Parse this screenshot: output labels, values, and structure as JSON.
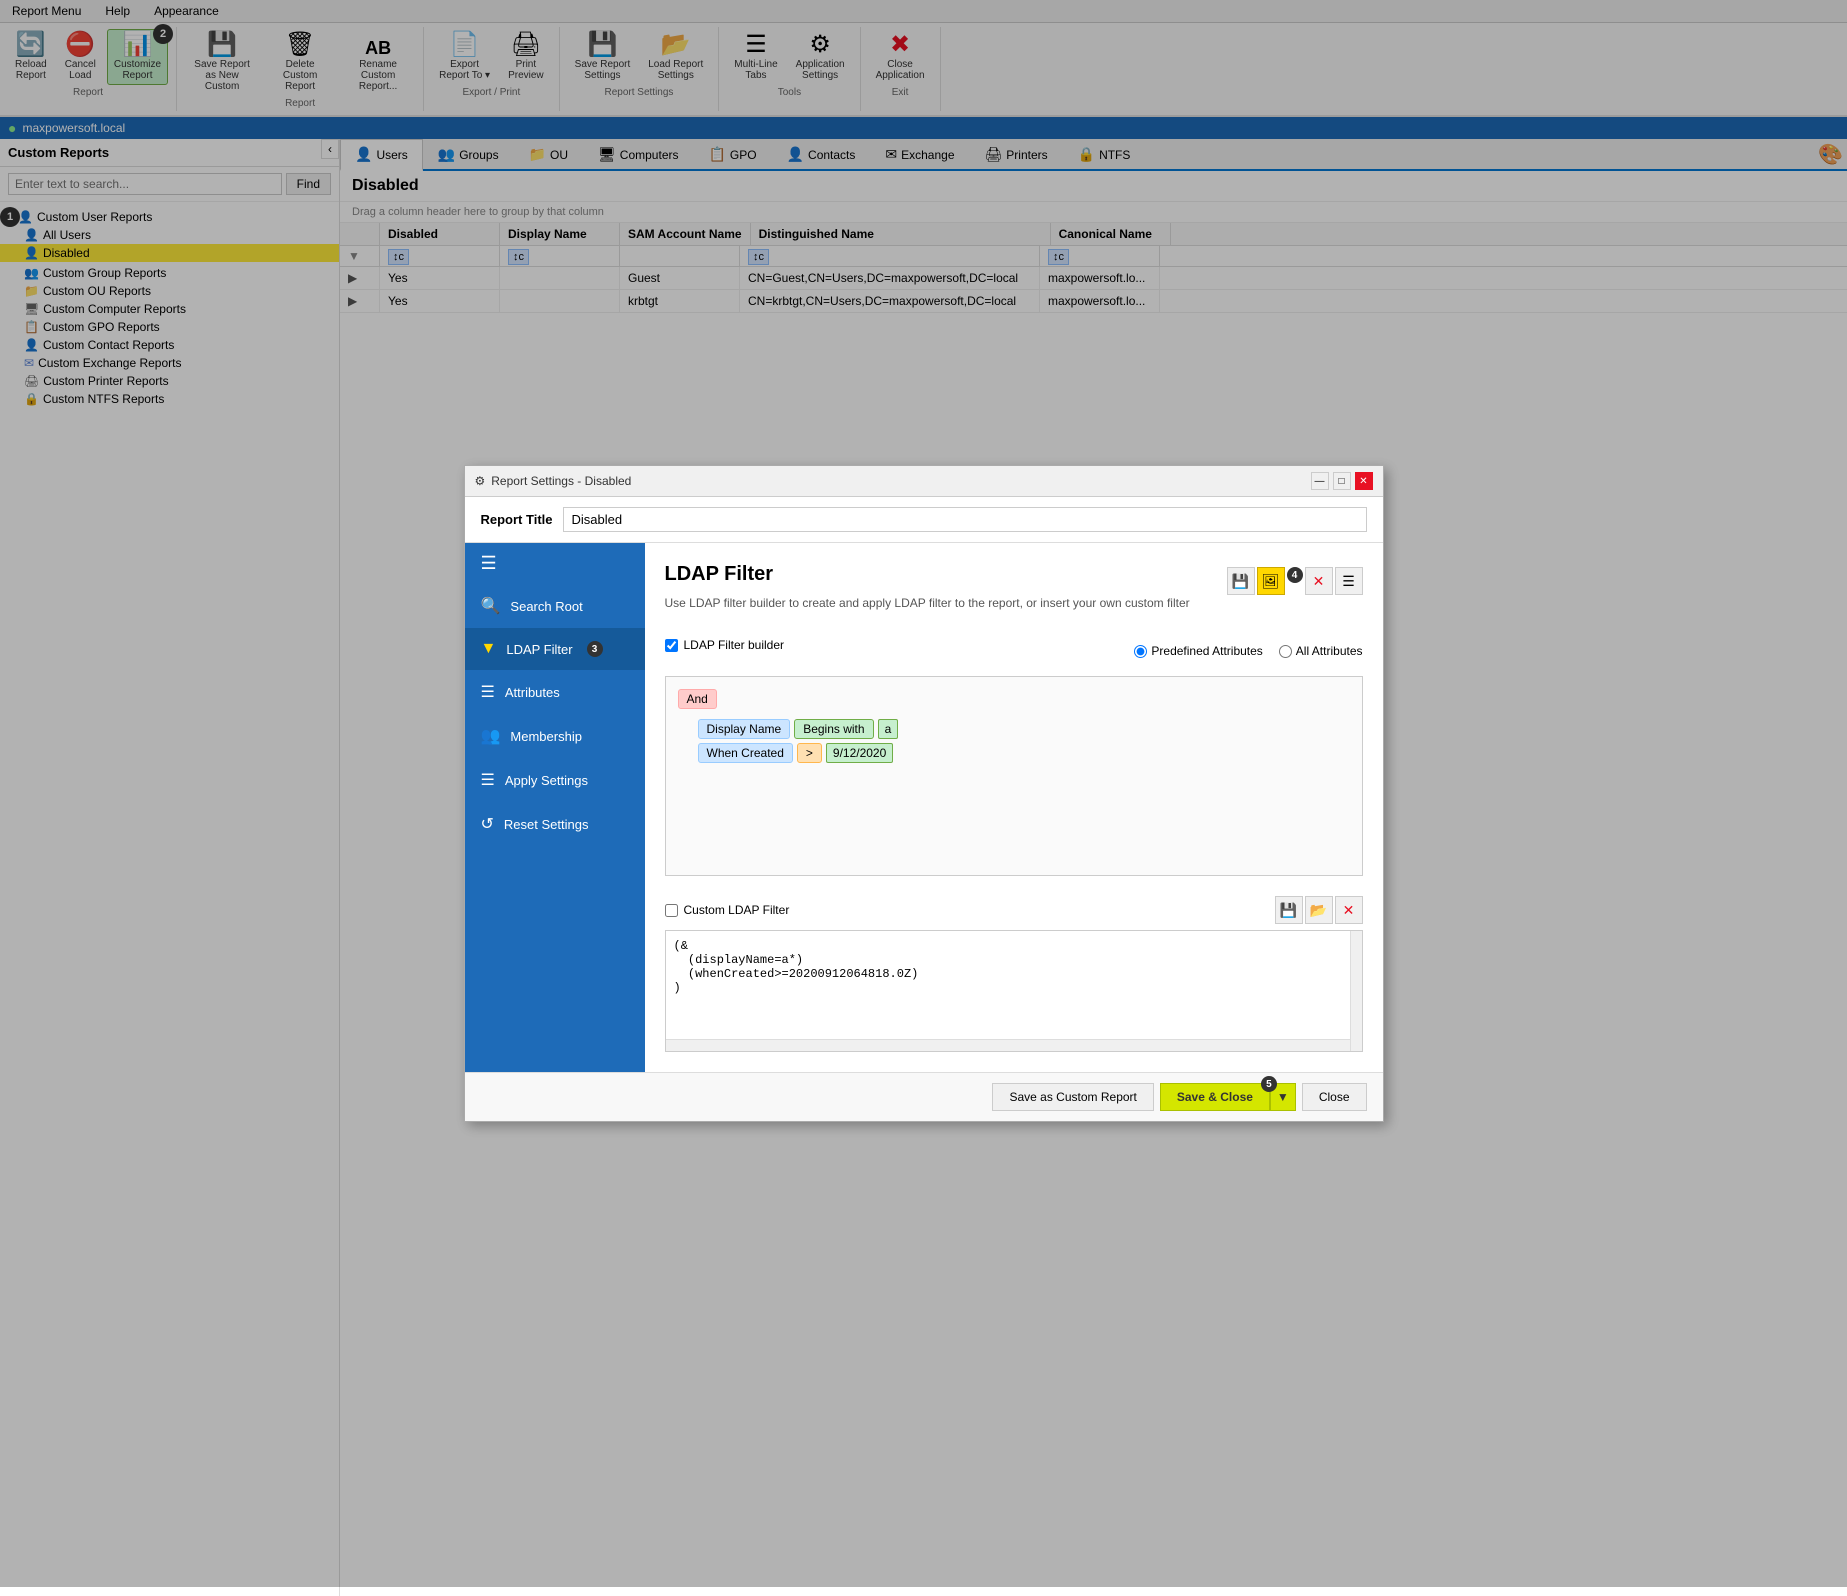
{
  "menubar": {
    "items": [
      "Report Menu",
      "Help",
      "Appearance"
    ]
  },
  "ribbon": {
    "groups": [
      {
        "label": "Report",
        "buttons": [
          {
            "id": "reload",
            "icon": "🔄",
            "label": "Reload\nReport",
            "active": false
          },
          {
            "id": "cancel",
            "icon": "⛔",
            "label": "Cancel\nLoad",
            "active": false
          },
          {
            "id": "customize",
            "icon": "📊",
            "label": "Customize\nReport",
            "active": true
          }
        ]
      },
      {
        "label": "Report",
        "buttons": [
          {
            "id": "save-new",
            "icon": "💾",
            "label": "Save Report\nas New Custom",
            "active": false
          },
          {
            "id": "delete",
            "icon": "🗑",
            "label": "Delete Custom\nReport",
            "active": false
          },
          {
            "id": "rename",
            "icon": "AB",
            "label": "Rename Custom\nReport...",
            "active": false
          }
        ]
      },
      {
        "label": "Export / Print",
        "buttons": [
          {
            "id": "export",
            "icon": "📄",
            "label": "Export\nReport To ▾",
            "active": false
          },
          {
            "id": "print",
            "icon": "🖨",
            "label": "Print\nPreview",
            "active": false
          }
        ]
      },
      {
        "label": "Report Settings",
        "buttons": [
          {
            "id": "save-settings",
            "icon": "💾",
            "label": "Save Report\nSettings",
            "active": false
          },
          {
            "id": "load-settings",
            "icon": "📂",
            "label": "Load Report\nSettings",
            "active": false
          }
        ]
      },
      {
        "label": "Tools",
        "buttons": [
          {
            "id": "multiline",
            "icon": "☰",
            "label": "Multi-Line\nTabs",
            "active": false
          },
          {
            "id": "app-settings",
            "icon": "⚙",
            "label": "Application\nSettings",
            "active": false
          }
        ]
      },
      {
        "label": "Exit",
        "buttons": [
          {
            "id": "close",
            "icon": "✖",
            "label": "Close\nApplication",
            "active": false
          }
        ]
      }
    ]
  },
  "statusbar": {
    "server": "maxpowersoft.local"
  },
  "sidebar": {
    "title": "Custom Reports",
    "search_placeholder": "Enter text to search...",
    "find_label": "Find",
    "groups": [
      {
        "label": "Custom User Reports",
        "icon": "👤",
        "items": [
          {
            "label": "All Users",
            "selected": false,
            "highlighted": false
          },
          {
            "label": "Disabled",
            "selected": true,
            "highlighted": true
          }
        ]
      },
      {
        "label": "Custom Group Reports",
        "icon": "👥"
      },
      {
        "label": "Custom OU Reports",
        "icon": "📁"
      },
      {
        "label": "Custom Computer Reports",
        "icon": "🖥"
      },
      {
        "label": "Custom GPO Reports",
        "icon": "📋"
      },
      {
        "label": "Custom Contact Reports",
        "icon": "👤"
      },
      {
        "label": "Custom Exchange Reports",
        "icon": "✉"
      },
      {
        "label": "Custom Printer Reports",
        "icon": "🖨"
      },
      {
        "label": "Custom NTFS Reports",
        "icon": "🔒"
      }
    ]
  },
  "tabs": [
    {
      "label": "Users",
      "icon": "👤",
      "active": true
    },
    {
      "label": "Groups",
      "icon": "👥",
      "active": false
    },
    {
      "label": "OU",
      "icon": "📁",
      "active": false
    },
    {
      "label": "Computers",
      "icon": "🖥",
      "active": false
    },
    {
      "label": "GPO",
      "icon": "📋",
      "active": false
    },
    {
      "label": "Contacts",
      "icon": "👤",
      "active": false
    },
    {
      "label": "Exchange",
      "icon": "✉",
      "active": false
    },
    {
      "label": "Printers",
      "icon": "🖨",
      "active": false
    },
    {
      "label": "NTFS",
      "icon": "🔒",
      "active": false
    }
  ],
  "report": {
    "title": "Disabled",
    "hint": "Drag a column header here to group by that column",
    "columns": [
      "Disabled",
      "Display Name",
      "SAM Account Name",
      "Distinguished Name",
      "Canonical Name"
    ],
    "rows": [
      {
        "disabled": "Yes",
        "display": "",
        "sam": "Guest",
        "dn": "CN=Guest,CN=Users,DC=maxpowersoft,DC=local",
        "canonical": "maxpowersoft.lo..."
      },
      {
        "disabled": "Yes",
        "display": "",
        "sam": "krbtgt",
        "dn": "CN=krbtgt,CN=Users,DC=maxpowersoft,DC=local",
        "canonical": "maxpowersoft.lo..."
      }
    ]
  },
  "modal": {
    "title": "Report Settings - Disabled",
    "report_title_label": "Report Title",
    "report_title_value": "Disabled",
    "sections": {
      "search_root": "Search Root",
      "ldap_filter": "LDAP Filter",
      "attributes": "Attributes",
      "membership": "Membership",
      "apply_settings": "Apply Settings",
      "reset_settings": "Reset Settings"
    },
    "ldap": {
      "section_title": "LDAP Filter",
      "description": "Use LDAP filter builder to create and apply LDAP filter to the report, or insert your own custom filter",
      "builder_checkbox": "LDAP Filter builder",
      "predefined_radio": "Predefined Attributes",
      "all_radio": "All Attributes",
      "and_tag": "And",
      "conditions": [
        {
          "field": "Display Name",
          "operator": "Begins with",
          "value": "a"
        },
        {
          "field": "When Created",
          "operator": ">",
          "value": "9/12/2020"
        }
      ],
      "custom_label": "Custom LDAP Filter",
      "custom_value": "(&\n  (displayName=a*)\n  (whenCreated>=20200912064818.0Z)\n)"
    },
    "footer": {
      "save_custom": "Save as Custom Report",
      "save_close": "Save & Close",
      "close": "Close"
    }
  },
  "labels": {
    "n1": "1",
    "n2": "2",
    "n3": "3",
    "n4": "4",
    "n5": "5"
  }
}
